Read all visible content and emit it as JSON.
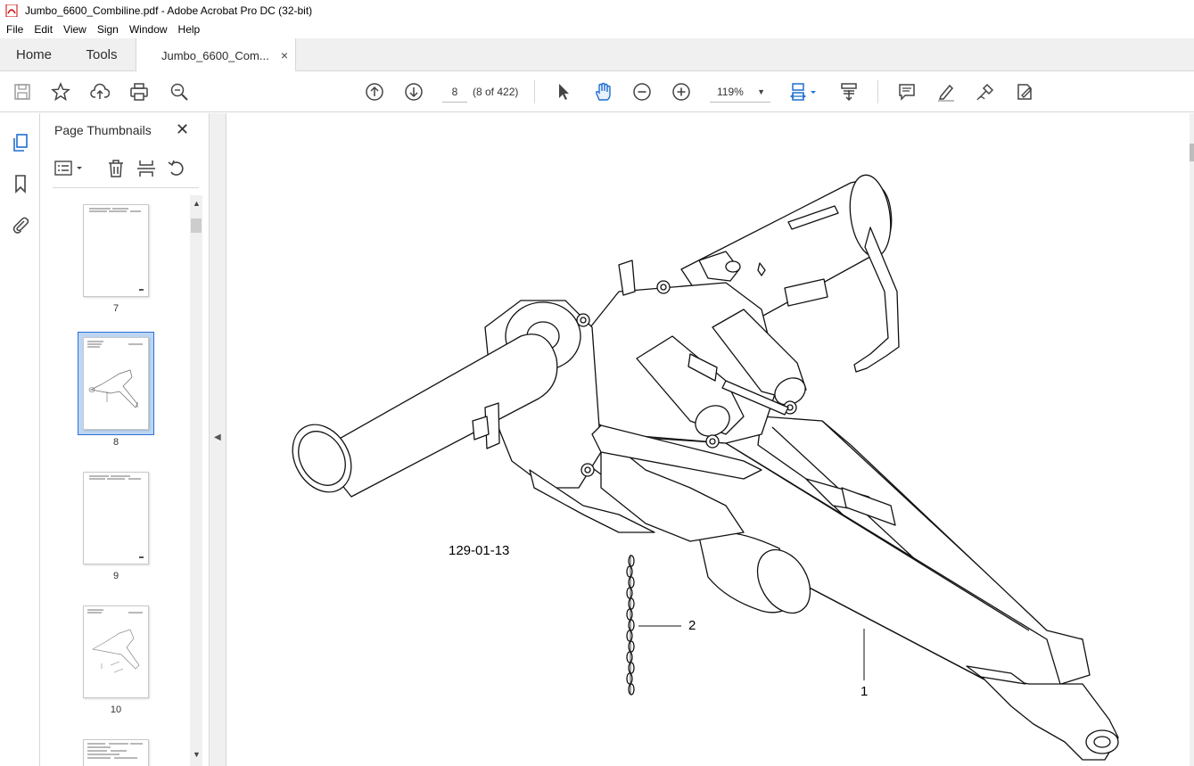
{
  "window": {
    "title": "Jumbo_6600_Combiline.pdf - Adobe Acrobat Pro DC (32-bit)"
  },
  "menu": [
    "File",
    "Edit",
    "View",
    "Sign",
    "Window",
    "Help"
  ],
  "tabs": {
    "home": "Home",
    "tools": "Tools",
    "document": "Jumbo_6600_Com...",
    "close": "×"
  },
  "toolbar": {
    "page_number": "8",
    "page_count": "(8 of 422)",
    "zoom": "119%"
  },
  "panel": {
    "title": "Page Thumbnails",
    "close": "✕",
    "thumbnails": [
      {
        "label": "7"
      },
      {
        "label": "8"
      },
      {
        "label": "9"
      },
      {
        "label": "10"
      }
    ]
  },
  "drawing": {
    "reference": "129-01-13",
    "callout_1": "1",
    "callout_2": "2"
  }
}
